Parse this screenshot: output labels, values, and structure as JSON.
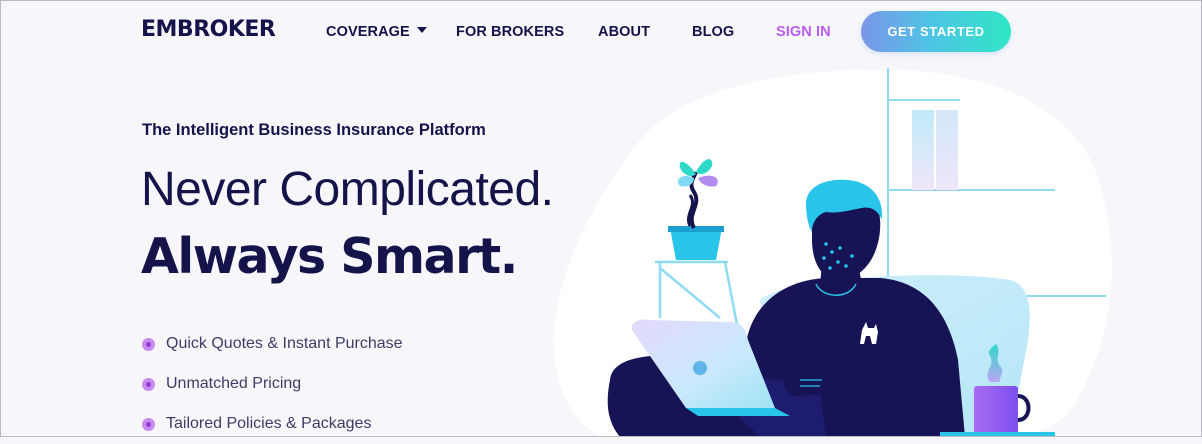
{
  "nav": {
    "logo": "EMBROKER",
    "items": [
      {
        "label": "COVERAGE",
        "has_dropdown": true
      },
      {
        "label": "FOR BROKERS"
      },
      {
        "label": "ABOUT"
      },
      {
        "label": "BLOG"
      },
      {
        "label": "SIGN IN"
      }
    ],
    "cta_label": "GET STARTED"
  },
  "hero": {
    "eyebrow": "The Intelligent Business Insurance Platform",
    "headline_line1": "Never Complicated.",
    "headline_line2": "Always Smart.",
    "bullets": [
      "Quick Quotes & Instant Purchase",
      "Unmatched Pricing",
      "Tailored Policies & Packages"
    ]
  },
  "colors": {
    "navy": "#14134a",
    "signin_purple": "#b95cf0",
    "bullet_purple": "#c98cf0",
    "cta_gradient_start": "#7b95e8",
    "cta_gradient_end": "#2ee6c5",
    "teal": "#29c4e9"
  },
  "icons": {
    "coverage_dropdown": "caret-down-icon",
    "bullet": "purple-dot-icon"
  }
}
